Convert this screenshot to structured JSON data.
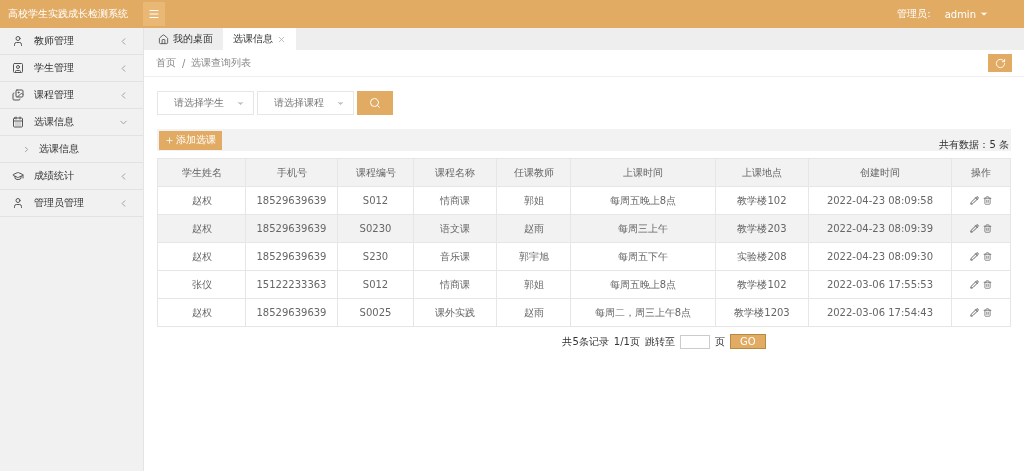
{
  "header": {
    "title": "高校学生实践成长检测系统",
    "user_label": "管理员:",
    "user_name": "admin"
  },
  "sidebar": {
    "items": [
      {
        "label": "教师管理",
        "expanded": false
      },
      {
        "label": "学生管理",
        "expanded": false
      },
      {
        "label": "课程管理",
        "expanded": false
      },
      {
        "label": "选课信息",
        "expanded": true,
        "children": [
          {
            "label": "选课信息"
          }
        ]
      },
      {
        "label": "成绩统计",
        "expanded": false
      },
      {
        "label": "管理员管理",
        "expanded": false
      }
    ]
  },
  "tabs": [
    {
      "label": "我的桌面",
      "kind": "home",
      "selected": false
    },
    {
      "label": "选课信息",
      "kind": "closable",
      "selected": true
    }
  ],
  "breadcrumb": {
    "separator": "/",
    "items": [
      "首页",
      "选课查询列表"
    ]
  },
  "filters": [
    {
      "placeholder": "请选择学生"
    },
    {
      "placeholder": "请选择课程"
    }
  ],
  "add_button": "添加选课",
  "total": "共有数据：5 条",
  "table": {
    "columns": [
      "学生姓名",
      "手机号",
      "课程编号",
      "课程名称",
      "任课教师",
      "上课时间",
      "上课地点",
      "创建时间",
      "操作"
    ],
    "rows": [
      {
        "selected": false,
        "cells": [
          "赵权",
          "18529639639",
          "S012",
          "情商课",
          "郭姐",
          "每周五晚上8点",
          "教学楼102",
          "2022-04-23 08:09:58"
        ]
      },
      {
        "selected": true,
        "cells": [
          "赵权",
          "18529639639",
          "S0230",
          "语文课",
          "赵雨",
          "每周三上午",
          "教学楼203",
          "2022-04-23 08:09:39"
        ]
      },
      {
        "selected": false,
        "cells": [
          "赵权",
          "18529639639",
          "S230",
          "音乐课",
          "郭宇旭",
          "每周五下午",
          "实验楼208",
          "2022-04-23 08:09:30"
        ]
      },
      {
        "selected": false,
        "cells": [
          "张仪",
          "15122233363",
          "S012",
          "情商课",
          "郭姐",
          "每周五晚上8点",
          "教学楼102",
          "2022-03-06 17:55:53"
        ]
      },
      {
        "selected": false,
        "cells": [
          "赵权",
          "18529639639",
          "S0025",
          "课外实践",
          "赵雨",
          "每周二，周三上午8点",
          "教学楼1203",
          "2022-03-06 17:54:43"
        ]
      }
    ]
  },
  "pager": {
    "summary": "共5条记录",
    "pages": "1/1页",
    "jump_label": "跳转至",
    "page_unit": "页",
    "go": "GO"
  }
}
